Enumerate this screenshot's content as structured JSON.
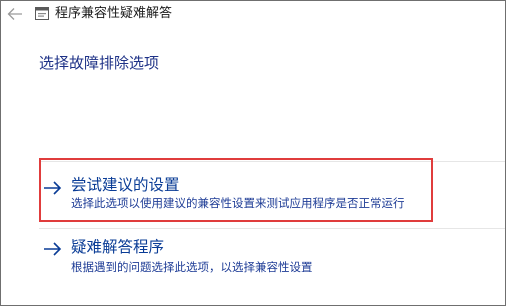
{
  "window": {
    "title": "程序兼容性疑难解答"
  },
  "main": {
    "heading": "选择故障排除选项",
    "options": [
      {
        "title": "尝试建议的设置",
        "description": "选择此选项以使用建议的兼容性设置来测试应用程序是否正常运行",
        "icon": "arrow-right-icon"
      },
      {
        "title": "疑难解答程序",
        "description": "根据遇到的问题选择此选项，以选择兼容性设置",
        "icon": "arrow-right-icon"
      }
    ]
  },
  "colors": {
    "link": "#0a3c96",
    "heading": "#1e3287",
    "highlight": "#e03c3c"
  }
}
